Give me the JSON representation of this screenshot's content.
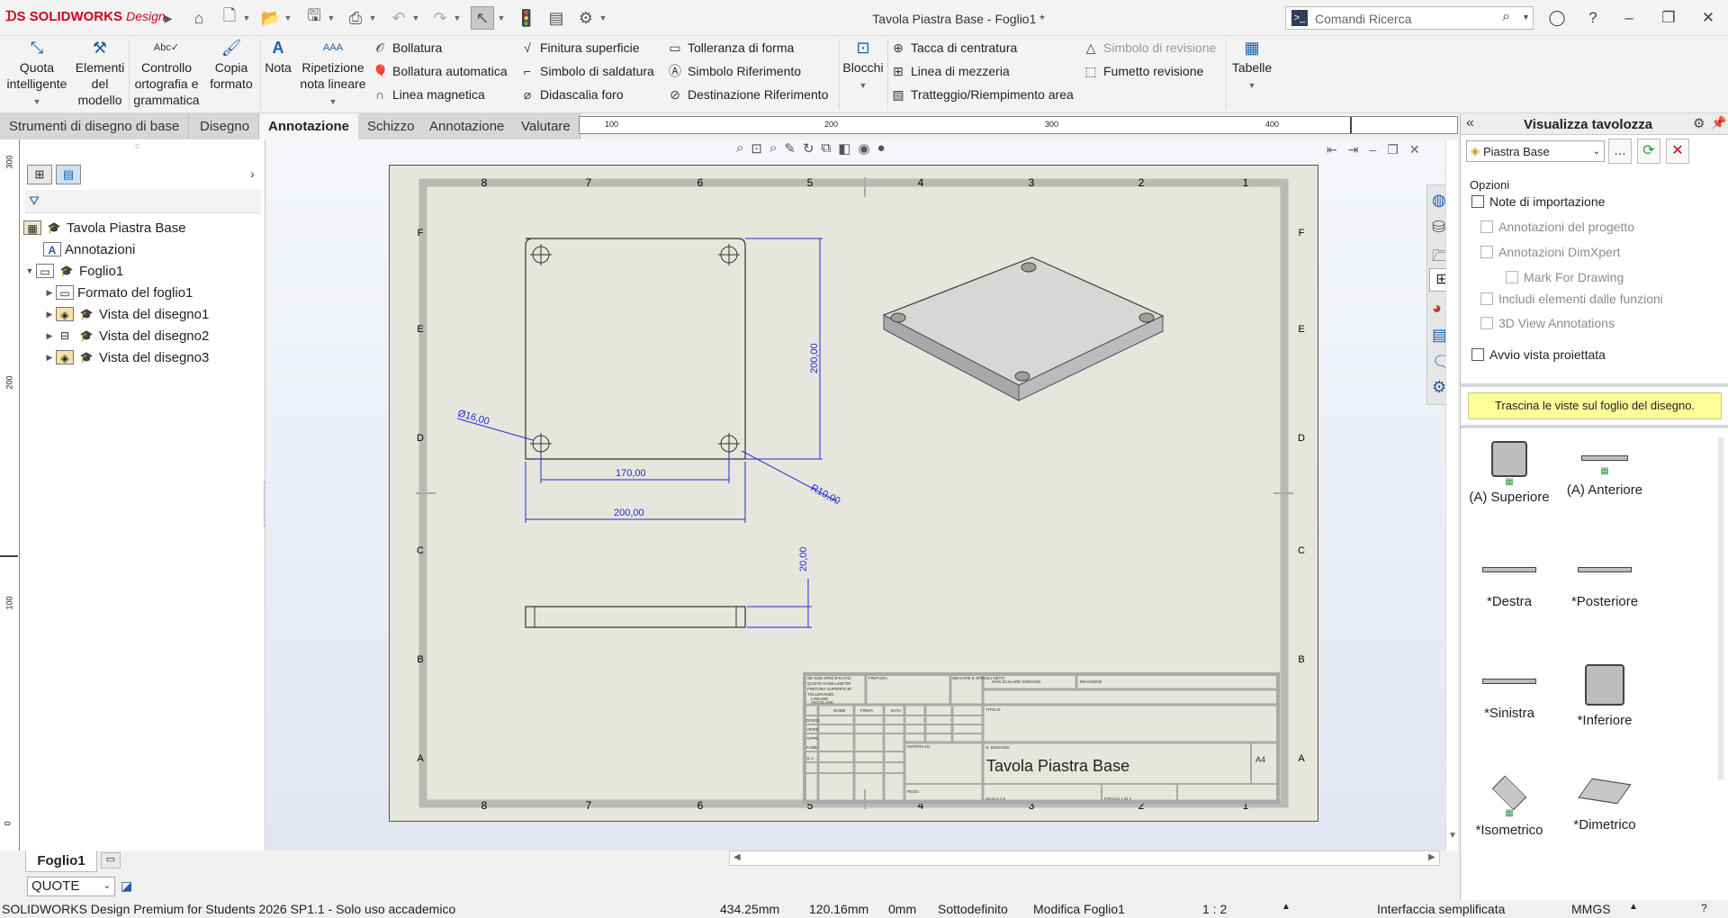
{
  "app": {
    "logo": "SOLIDWORKS",
    "logo_suffix": "Design",
    "window_title": "Tavola Piastra Base - Foglio1 *"
  },
  "search": {
    "placeholder": "Comandi Ricerca"
  },
  "ribbon": {
    "big": [
      "Quota intelligente",
      "Elementi del modello",
      "Controllo ortografia e grammatica",
      "Copia formato",
      "Nota",
      "Ripetizione nota lineare",
      "Blocchi",
      "Tabelle"
    ],
    "col1": [
      "Bollatura",
      "Bollatura automatica",
      "Linea magnetica"
    ],
    "col2": [
      "Finitura superficie",
      "Simbolo di saldatura",
      "Didascalia foro"
    ],
    "col3": [
      "Tolleranza di forma",
      "Simbolo Riferimento",
      "Destinazione Riferimento"
    ],
    "col4": [
      "Tacca di centratura",
      "Linea di mezzeria",
      "Tratteggio/Riempimento area"
    ],
    "col5": [
      "Simbolo di revisione",
      "Fumetto revisione"
    ]
  },
  "tabs": [
    "Strumenti di disegno di base",
    "Disegno",
    "Annotazione",
    "Schizzo",
    "Annotazione",
    "Valutare"
  ],
  "tree": {
    "root": "Tavola Piastra Base",
    "items": [
      "Annotazioni",
      "Foglio1",
      "Formato del foglio1",
      "Vista del disegno1",
      "Vista del disegno2",
      "Vista del disegno3"
    ]
  },
  "ruler": {
    "h": [
      "100",
      "200",
      "300",
      "400"
    ],
    "v": [
      "300",
      "200",
      "100",
      "0"
    ]
  },
  "sheet": {
    "cols": [
      "8",
      "7",
      "6",
      "5",
      "4",
      "3",
      "2",
      "1"
    ],
    "rows": [
      "F",
      "E",
      "D",
      "C",
      "B",
      "A"
    ],
    "dims": {
      "d1": "Ø16,00",
      "d2": "200,00",
      "d3": "170,00",
      "d4": "200,00",
      "d5": "R10,00",
      "d6": "20,00"
    },
    "title_block": "Tavola Piastra Base",
    "tb_small": [
      "SE NON SPECIFICATO:",
      "QUOTE IN MILLIMETRI",
      "FINITURA SUPERFICIE:",
      "TOLLERANZE:",
      "LINEARE:",
      "ANGOLARE:",
      "FINITURA:",
      "SBAVARE E SPIGOLI NETTI",
      "NON SCALARE DISEGNO",
      "REVISIONE",
      "NOME",
      "FIRMA",
      "DATA",
      "DISEG.",
      "VERIF.",
      "APPR.",
      "FABB.",
      "Q.A.",
      "MATERIALE:",
      "TITOLO:",
      "PESO:",
      "SCALA:1:2",
      "N. DISEGNO",
      "FOGLIO 1 DI 1",
      "A4"
    ]
  },
  "sheet_tab": "Foglio1",
  "quote_select": "QUOTE",
  "taskpane": {
    "title": "Visualizza tavolozza",
    "doc_select": "Piastra Base",
    "options_label": "Opzioni",
    "checkboxes": [
      "Note di importazione",
      "Annotazioni del progetto",
      "Annotazioni DimXpert",
      "Mark For Drawing",
      "Includi elementi dalle funzioni",
      "3D View Annotations",
      "Avvio vista proiettata"
    ],
    "hint": "Trascina le viste sul foglio del disegno.",
    "views": [
      "(A) Superiore",
      "(A) Anteriore",
      "*Destra",
      "*Posteriore",
      "*Sinistra",
      "*Inferiore",
      "*Isometrico",
      "*Dimetrico"
    ]
  },
  "status": {
    "product": "SOLIDWORKS Design Premium for Students 2026 SP1.1 - Solo uso accademico",
    "x": "434.25mm",
    "y": "120.16mm",
    "z": "0mm",
    "state": "Sottodefinito",
    "mode": "Modifica Foglio1",
    "scale": "1 : 2",
    "ui": "Interfaccia semplificata",
    "units": "MMGS"
  }
}
